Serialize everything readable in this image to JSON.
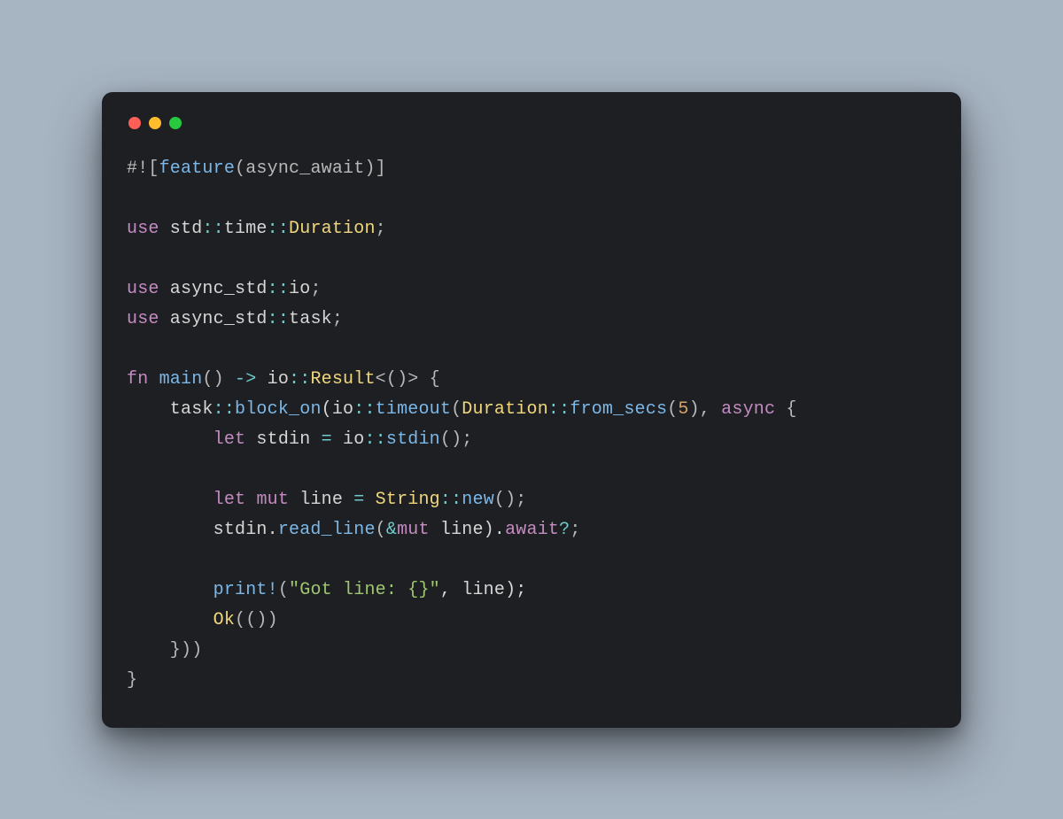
{
  "colors": {
    "background": "#a7b4c2",
    "window": "#1e1f23",
    "dot_red": "#ff5f56",
    "dot_yellow": "#ffbd2e",
    "dot_green": "#27c93f",
    "keyword": "#c38bc1",
    "type": "#f0d77b",
    "function": "#7bb8e8",
    "number": "#d6a36a",
    "string": "#9fc76f",
    "operator": "#6fcdcd",
    "text": "#d6d6d6"
  },
  "code": {
    "lines": [
      [
        {
          "t": "#![",
          "c": "punc"
        },
        {
          "t": "feature",
          "c": "fn"
        },
        {
          "t": "(async_await)]",
          "c": "punc"
        }
      ],
      [],
      [
        {
          "t": "use",
          "c": "kw"
        },
        {
          "t": " std",
          "c": "id"
        },
        {
          "t": "::",
          "c": "op"
        },
        {
          "t": "time",
          "c": "id"
        },
        {
          "t": "::",
          "c": "op"
        },
        {
          "t": "Duration",
          "c": "ty"
        },
        {
          "t": ";",
          "c": "punc"
        }
      ],
      [],
      [
        {
          "t": "use",
          "c": "kw"
        },
        {
          "t": " async_std",
          "c": "id"
        },
        {
          "t": "::",
          "c": "op"
        },
        {
          "t": "io",
          "c": "id"
        },
        {
          "t": ";",
          "c": "punc"
        }
      ],
      [
        {
          "t": "use",
          "c": "kw"
        },
        {
          "t": " async_std",
          "c": "id"
        },
        {
          "t": "::",
          "c": "op"
        },
        {
          "t": "task",
          "c": "id"
        },
        {
          "t": ";",
          "c": "punc"
        }
      ],
      [],
      [
        {
          "t": "fn",
          "c": "kw"
        },
        {
          "t": " ",
          "c": "id"
        },
        {
          "t": "main",
          "c": "fn"
        },
        {
          "t": "() ",
          "c": "punc"
        },
        {
          "t": "->",
          "c": "op"
        },
        {
          "t": " io",
          "c": "id"
        },
        {
          "t": "::",
          "c": "op"
        },
        {
          "t": "Result",
          "c": "ty"
        },
        {
          "t": "<()>",
          "c": "punc"
        },
        {
          "t": " {",
          "c": "punc"
        }
      ],
      [
        {
          "t": "    task",
          "c": "id"
        },
        {
          "t": "::",
          "c": "op"
        },
        {
          "t": "block_on",
          "c": "fn"
        },
        {
          "t": "(io",
          "c": "id"
        },
        {
          "t": "::",
          "c": "op"
        },
        {
          "t": "timeout",
          "c": "fn"
        },
        {
          "t": "(",
          "c": "punc"
        },
        {
          "t": "Duration",
          "c": "ty"
        },
        {
          "t": "::",
          "c": "op"
        },
        {
          "t": "from_secs",
          "c": "fn"
        },
        {
          "t": "(",
          "c": "punc"
        },
        {
          "t": "5",
          "c": "num"
        },
        {
          "t": "), ",
          "c": "punc"
        },
        {
          "t": "async",
          "c": "kw"
        },
        {
          "t": " {",
          "c": "punc"
        }
      ],
      [
        {
          "t": "        ",
          "c": "id"
        },
        {
          "t": "let",
          "c": "kw"
        },
        {
          "t": " stdin ",
          "c": "id"
        },
        {
          "t": "=",
          "c": "op"
        },
        {
          "t": " io",
          "c": "id"
        },
        {
          "t": "::",
          "c": "op"
        },
        {
          "t": "stdin",
          "c": "fn"
        },
        {
          "t": "();",
          "c": "punc"
        }
      ],
      [],
      [
        {
          "t": "        ",
          "c": "id"
        },
        {
          "t": "let",
          "c": "kw"
        },
        {
          "t": " ",
          "c": "id"
        },
        {
          "t": "mut",
          "c": "kw"
        },
        {
          "t": " line ",
          "c": "id"
        },
        {
          "t": "=",
          "c": "op"
        },
        {
          "t": " ",
          "c": "id"
        },
        {
          "t": "String",
          "c": "ty"
        },
        {
          "t": "::",
          "c": "op"
        },
        {
          "t": "new",
          "c": "fn"
        },
        {
          "t": "();",
          "c": "punc"
        }
      ],
      [
        {
          "t": "        stdin.",
          "c": "id"
        },
        {
          "t": "read_line",
          "c": "fn"
        },
        {
          "t": "(",
          "c": "punc"
        },
        {
          "t": "&",
          "c": "op"
        },
        {
          "t": "mut",
          "c": "kw"
        },
        {
          "t": " line).",
          "c": "id"
        },
        {
          "t": "await",
          "c": "kw"
        },
        {
          "t": "?",
          "c": "op"
        },
        {
          "t": ";",
          "c": "punc"
        }
      ],
      [],
      [
        {
          "t": "        ",
          "c": "id"
        },
        {
          "t": "print!",
          "c": "fn"
        },
        {
          "t": "(",
          "c": "punc"
        },
        {
          "t": "\"Got line: {}\"",
          "c": "str"
        },
        {
          "t": ", line);",
          "c": "id"
        }
      ],
      [
        {
          "t": "        ",
          "c": "id"
        },
        {
          "t": "Ok",
          "c": "ty"
        },
        {
          "t": "(())",
          "c": "punc"
        }
      ],
      [
        {
          "t": "    }))",
          "c": "punc"
        }
      ],
      [
        {
          "t": "}",
          "c": "punc"
        }
      ]
    ]
  }
}
